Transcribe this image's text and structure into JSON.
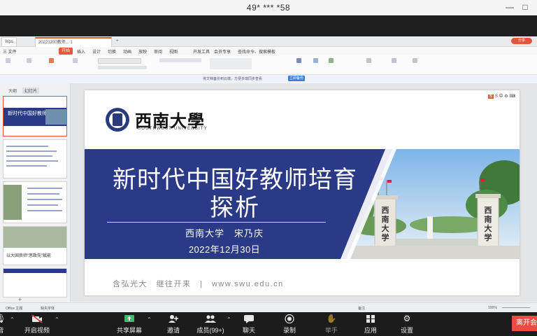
{
  "window": {
    "title": "49*  ***  *58",
    "min_glyph": "—",
    "restore_glyph": "□"
  },
  "wps": {
    "tabs": [
      "Wps",
      "20221230教师... 1 ",
      "+"
    ],
    "menu": [
      "三 文件",
      "开始",
      "插入",
      "设计",
      "切换",
      "动画",
      "放映",
      "审阅",
      "视图",
      "开发工具",
      "会员专享",
      "查找命令、搜索模板"
    ],
    "right_account": "分享",
    "notice": {
      "text": "将文档备份到云端，方便多端同步查看",
      "button": "立即备份"
    },
    "left_pane_tabs": [
      "大纲",
      "幻灯片"
    ],
    "thumbnails": [
      {
        "num": "1",
        "title": "新时代中国好教师培育探析"
      },
      {
        "num": "2",
        "title": ""
      },
      {
        "num": "3",
        "title": ""
      },
      {
        "num": "4",
        "title": "以大国良师“思政先”赋能"
      },
      {
        "num": "5",
        "title": ""
      }
    ],
    "add_slide": "+",
    "status": {
      "left1": "Office 主题",
      "left2": "缺失字体",
      "notes": "备注",
      "zoom": "100%"
    },
    "wps_badge": "S 中 ⚙ ⌨"
  },
  "slide": {
    "university_cn": "西南大學",
    "university_en": "SOUTHWEST UNIVERSITY",
    "title_line1": "新时代中国好教师培育",
    "title_line2": "探析",
    "author": "西南大学　宋乃庆",
    "date": "2022年12月30日",
    "motto": "含弘光大　继往开来　|　www.swu.edu.cn",
    "gate_plaque": "西南大学"
  },
  "meeting_toolbar": {
    "items": [
      {
        "label": "音",
        "icon": "mic-icon"
      },
      {
        "label": "开启视频",
        "icon": "camera-off-icon"
      },
      {
        "label": "共享屏幕",
        "icon": "share-screen-icon"
      },
      {
        "label": "邀请",
        "icon": "invite-icon"
      },
      {
        "label": "成员(99+)",
        "icon": "members-icon"
      },
      {
        "label": "聊天",
        "icon": "chat-icon"
      },
      {
        "label": "录制",
        "icon": "record-icon"
      },
      {
        "label": "举手",
        "icon": "raise-hand-icon"
      },
      {
        "label": "应用",
        "icon": "apps-icon"
      },
      {
        "label": "设置",
        "icon": "settings-icon"
      }
    ],
    "leave": "离开会"
  }
}
